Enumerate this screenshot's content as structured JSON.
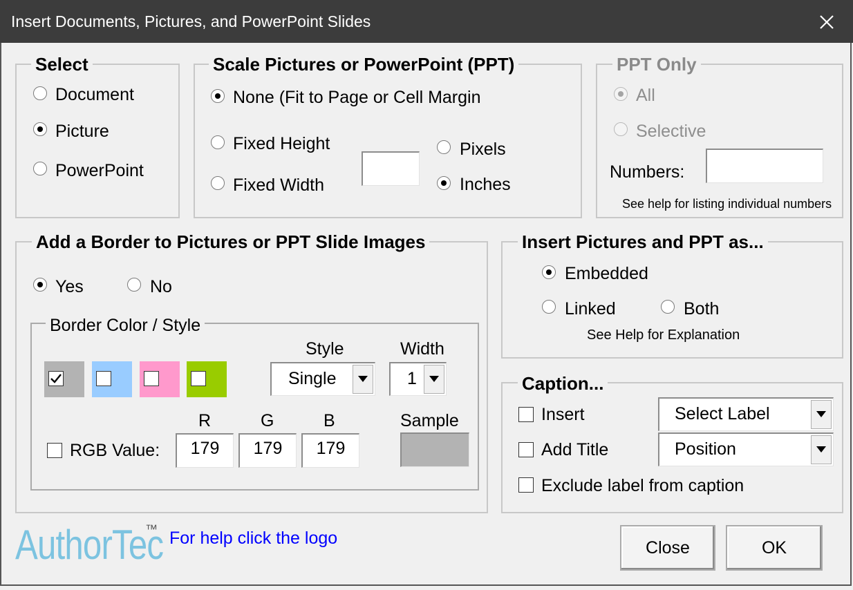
{
  "window": {
    "title": "Insert Documents, Pictures, and PowerPoint Slides"
  },
  "select_group": {
    "title": "Select",
    "options": [
      "Document",
      "Picture",
      "PowerPoint"
    ],
    "selected": "Picture"
  },
  "scale_group": {
    "title": "Scale Pictures or PowerPoint (PPT)",
    "none_label": "None (Fit to Page or Cell Margin",
    "fixed_height_label": "Fixed Height",
    "fixed_width_label": "Fixed Width",
    "size_value": "",
    "pixels_label": "Pixels",
    "inches_label": "Inches",
    "selected_scale": "None",
    "selected_unit": "Inches"
  },
  "ppt_group": {
    "title": "PPT Only",
    "all_label": "All",
    "selective_label": "Selective",
    "numbers_label": "Numbers:",
    "numbers_value": "",
    "hint": "See help for listing individual numbers",
    "selected": "All",
    "enabled": false
  },
  "border_group": {
    "title": "Add a Border to Pictures or PPT Slide Images",
    "yes_label": "Yes",
    "no_label": "No",
    "selected": "Yes",
    "color_style": {
      "title": "Border Color / Style",
      "swatches": [
        {
          "color": "#b3b3b3",
          "checked": true
        },
        {
          "color": "#99ccff",
          "checked": false
        },
        {
          "color": "#ff99cc",
          "checked": false
        },
        {
          "color": "#99cc00",
          "checked": false
        }
      ],
      "style_label": "Style",
      "style_value": "Single",
      "width_label": "Width",
      "width_value": "1",
      "rgb_label": "RGB Value:",
      "rgb_checked": false,
      "r_label": "R",
      "g_label": "G",
      "b_label": "B",
      "r_value": "179",
      "g_value": "179",
      "b_value": "179",
      "sample_label": "Sample",
      "sample_color": "#b3b3b3"
    }
  },
  "insert_as_group": {
    "title": "Insert Pictures and PPT as...",
    "embedded_label": "Embedded",
    "linked_label": "Linked",
    "both_label": "Both",
    "selected": "Embedded",
    "hint": "See Help for Explanation"
  },
  "caption_group": {
    "title": "Caption...",
    "insert_label": "Insert",
    "insert_checked": false,
    "add_title_label": "Add Title",
    "add_title_checked": false,
    "exclude_label": "Exclude label from caption",
    "exclude_checked": false,
    "label_select_value": "Select Label",
    "position_select_value": "Position"
  },
  "footer": {
    "logo_text": "AuthorTec",
    "logo_tm": "™",
    "help_link": "For help click the logo",
    "close_button": "Close",
    "ok_button": "OK",
    "link_color": "#0000ff",
    "logo_color": "#7cc3e0"
  }
}
